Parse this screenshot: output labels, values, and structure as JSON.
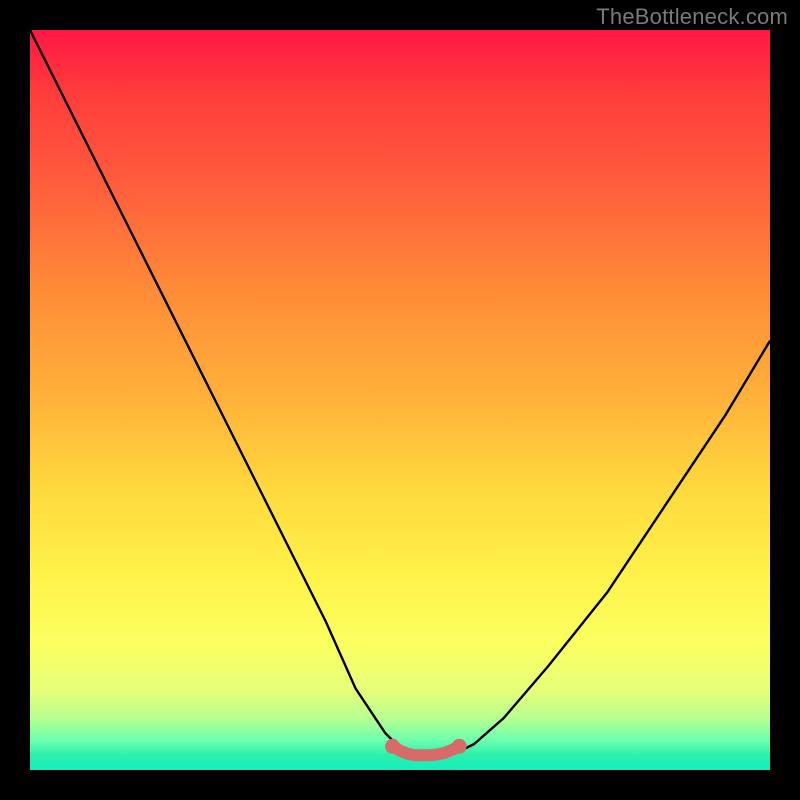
{
  "watermark": "TheBottleneck.com",
  "chart_data": {
    "type": "line",
    "title": "",
    "xlabel": "",
    "ylabel": "",
    "xlim": [
      0,
      100
    ],
    "ylim": [
      0,
      100
    ],
    "series": [
      {
        "name": "bottleneck-curve",
        "x": [
          0,
          5,
          10,
          15,
          20,
          25,
          30,
          35,
          40,
          44,
          48,
          50,
          53,
          56,
          58,
          60,
          64,
          70,
          78,
          86,
          94,
          100
        ],
        "y": [
          100,
          90,
          80,
          70,
          60,
          50,
          40,
          30,
          20,
          11,
          5,
          3,
          2,
          2,
          2.5,
          3.5,
          7,
          14,
          24,
          36,
          48,
          58
        ]
      },
      {
        "name": "optimal-flat-region",
        "x": [
          49,
          50,
          51,
          52,
          53,
          54,
          55,
          56,
          57,
          58
        ],
        "y": [
          3.2,
          2.6,
          2.2,
          2.0,
          2.0,
          2.0,
          2.1,
          2.3,
          2.7,
          3.2
        ]
      }
    ],
    "annotations": [],
    "colors": {
      "curve": "#000000",
      "optimal_region": "#e06666"
    }
  }
}
